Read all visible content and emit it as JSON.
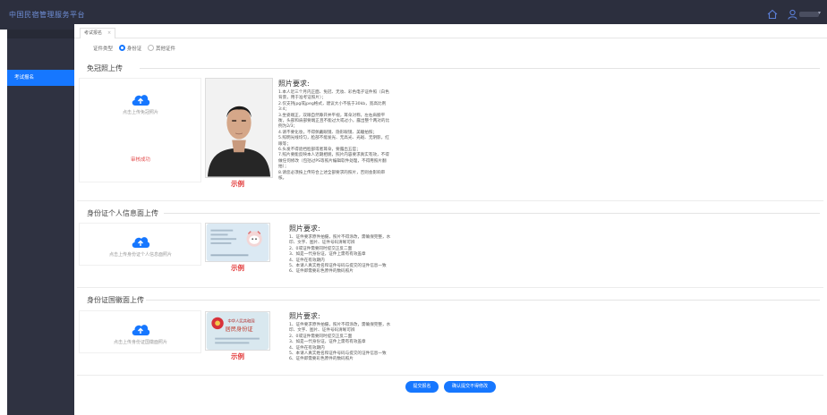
{
  "app": {
    "title": "中国民宿管理服务平台",
    "user_caret": "▾"
  },
  "sidebar": {
    "active_item": "考试报名"
  },
  "tab": {
    "label": "考试报名",
    "close": "×"
  },
  "cert_type": {
    "label": "证件类型",
    "options": [
      "身份证",
      "其他证件"
    ],
    "selected": "身份证"
  },
  "sections": [
    {
      "title": "免冠照上传",
      "upload_text": "点击上传免冠照片",
      "status": "审核成功",
      "sample_label": "示例",
      "req_title": "照片要求:",
      "requirements": [
        "1.本人近三个月内正面、免冠、无妆、彩色电子证件照（白色背景，用于准考证照片）；",
        "2.仅支持jpg或jpeg格式，建议大小不低于30kb，宽高比例3:4；",
        "3.坐姿端正，双眼自然睁开并平视，耳朵对称，左右肩膀平衡，头部和肩部要端正且不能过大或过小，露出整个两对的比例为2/3；",
        "4.请不要化妆，不得佩戴眼镜、隐形眼镜、美瞳拍照；",
        "5.照明光线均匀，脸部不能发光、无高光、光斑、无阴影，红眼等；",
        "6.头发不得遮挡脸部或者耳朵，要露出五官；",
        "7.照片要能反映本人近期相貌，照片内容要求真实有效，不得做任何修改（包括过PS等照片编辑软件处理，不得用照片翻拍）；",
        "8.请您必须按上传符合上述全部要求的照片，否则会影响审核。"
      ]
    },
    {
      "title": "身份证个人信息面上传",
      "upload_text": "点击上传身份证个人信息面照片",
      "sample_label": "示例",
      "req_title": "照片要求:",
      "requirements": [
        "1、证件要求原件拍摄，照片不得涂改，需确保完整，水印、文字、图片、证件号码清晰可辨",
        "2、0或证件需要同时提交正反二面",
        "3、如是一代身份证，证件上需有有效盖章",
        "4、证件在有效期内",
        "5、本请人真实姓名和证件号码与提交的证件信息一致",
        "6、证件即需要彩色原件的数码照片"
      ]
    },
    {
      "title": "身份证国徽面上传",
      "upload_text": "点击上传身份证国徽面照片",
      "sample_label": "示例",
      "card_emblem_text": "中华人民共和国",
      "card_title_text": "居民身份证",
      "req_title": "照片要求:",
      "requirements": [
        "1、证件要求原件拍摄，照片不得涂改，需确保完整，水印、文字、图片、证件号码清晰可辨",
        "2、0或证件需要同时提交正反二面",
        "3、如是一代身份证，证件上需有有效盖章",
        "4、证件在有效期内",
        "5、本请人真实姓名和证件号码与提交的证件信息一致",
        "6、证件即需要彩色原件的数码照片"
      ]
    }
  ],
  "buttons": {
    "submit": "提交报名",
    "confirm": "确认提交不得修改"
  },
  "colors": {
    "topbar": "#2c2f3e",
    "sidebar": "#2f3241",
    "accent": "#1677ff",
    "sample_red": "#e23a3a"
  }
}
